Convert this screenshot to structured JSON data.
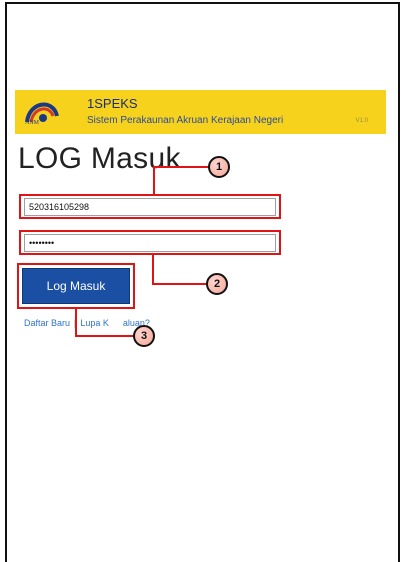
{
  "header": {
    "app_name": "1SPEKS",
    "subtitle": "Sistem Perakaunan Akruan Kerajaan Negeri",
    "version": "V1.0",
    "logo_text": "ANM"
  },
  "page": {
    "title": "LOG Masuk"
  },
  "form": {
    "username_value": "520316105298",
    "password_value": "••••••••",
    "login_button": "Log Masuk"
  },
  "links": {
    "register": "Daftar Baru",
    "separator": "|",
    "forgot_partial_a": "Lupa K",
    "forgot_partial_b": "aluan?"
  },
  "callouts": {
    "one": "1",
    "two": "2",
    "three": "3"
  },
  "colors": {
    "header_bg": "#f7d21d",
    "button_bg": "#1a4fa3",
    "highlight": "#e01414",
    "link": "#2f74c8"
  }
}
